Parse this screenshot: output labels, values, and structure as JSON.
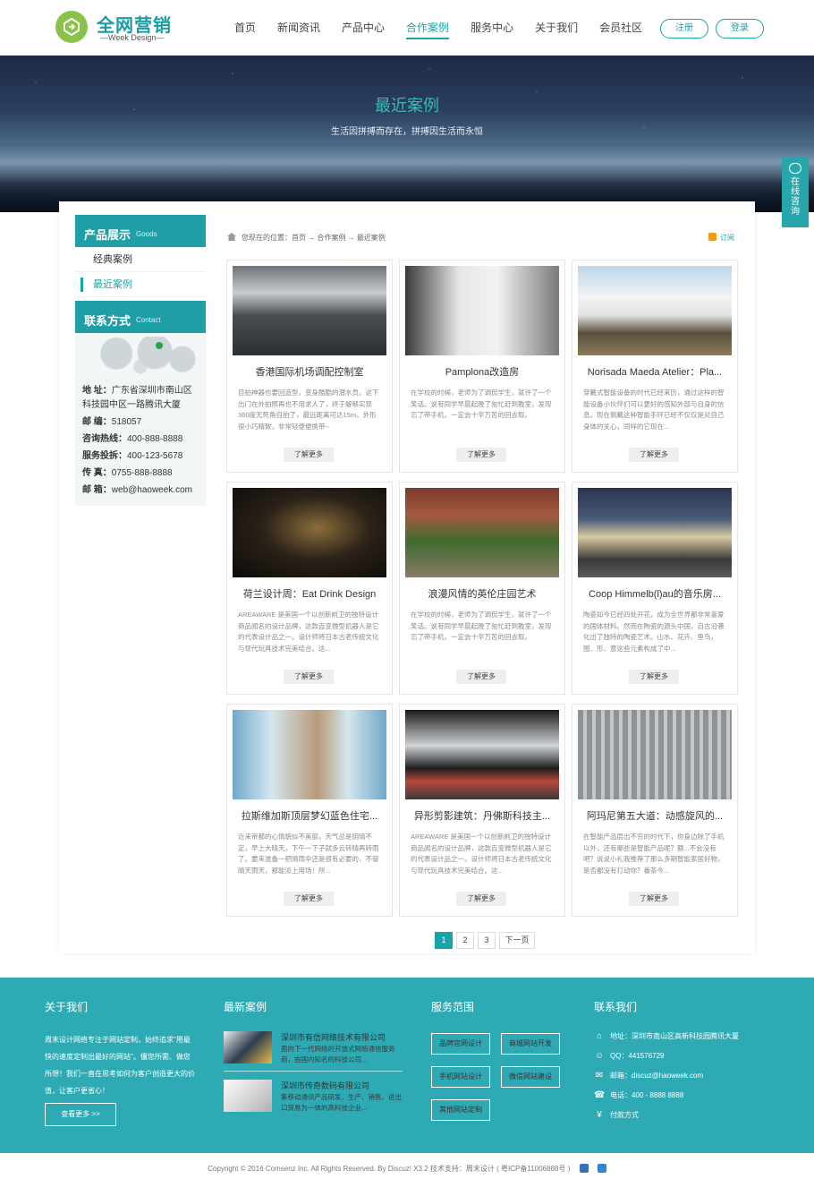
{
  "brand": {
    "name": "全网营销",
    "sub": "—Week Design—",
    "color": "#1aa3a8"
  },
  "nav": {
    "items": [
      {
        "label": "首页"
      },
      {
        "label": "新闻资讯"
      },
      {
        "label": "产品中心"
      },
      {
        "label": "合作案例",
        "active": true
      },
      {
        "label": "服务中心"
      },
      {
        "label": "关于我们"
      },
      {
        "label": "会员社区"
      }
    ],
    "register": "注册",
    "login": "登录"
  },
  "banner": {
    "title": "最近案例",
    "subtitle": "生活因拼搏而存在，拼搏因生活而永恒"
  },
  "consult": {
    "label": "在线咨询",
    "icon": "chat-icon"
  },
  "sidebar": {
    "products_title": "产品展示",
    "products_en": "Goods",
    "items": [
      {
        "label": "经典案例"
      },
      {
        "label": "最近案例",
        "active": true
      }
    ],
    "contact_title": "联系方式",
    "contact_en": "Contact",
    "address_label": "地 址：",
    "address_1": "广东省深圳市南山区",
    "address_2": "科技园中区一路腾讯大厦",
    "zip_label": "邮 编：",
    "zip": "518057",
    "hotline_label": "咨询热线：",
    "hotline": "400-888-8888",
    "complaint_label": "服务投拆：",
    "complaint": "400-123-5678",
    "fax_label": "传 真：",
    "fax": "0755-888-8888",
    "email_label": "邮 箱：",
    "email": "web@haoweek.com"
  },
  "breadcrumb": {
    "text": "您现在的位置：首页 → 合作案例 → 最近案例",
    "rss": "订阅"
  },
  "cases": [
    {
      "title": "香港国际机场调配控制室",
      "desc": "目拍神器也要回造型，变身酷酷的潜水员。这下出门在外拍照再也不用求人了，终于解够实现360度无死角自拍了，最远距离可达15m。外形很小巧精致，非常轻便便携带~",
      "more": "了解更多"
    },
    {
      "title": "Pamplona改造房",
      "desc": "在学校的时候，老师为了调侃学生，就许了一个笑话。说有同学早晨起晚了匆忙赶到教室，发现忘了带手机，一定会十辛万苦的回去取。",
      "more": "了解更多"
    },
    {
      "title": "Norisada Maeda Atelier：Pla...",
      "desc": "穿戴式智能设备的时代已经来历，通过这样的智能设备小伙伴们可以更好的感知外部与自身的信息。现在佩戴这种智能手环已经不仅仅是对自己身体的关心，同样的它现在...",
      "more": "了解更多"
    },
    {
      "title": "荷兰设计周：Eat Drink Design",
      "desc": "AREAWARE 是美国一个以创新前卫的独特设计商品闻名的设计品牌，这款百变微型机器人是它的代表设计品之一。设计师将日本古老传统文化与现代玩具技术完美结合。这...",
      "more": "了解更多"
    },
    {
      "title": "浪漫风情的英伦庄园艺术",
      "desc": "在学校的时候，老师为了调侃学生，就许了一个笑话。说有同学早晨起晚了匆忙赶到教室，发现忘了带手机，一定会十辛万苦的回去取。",
      "more": "了解更多"
    },
    {
      "title": "Coop Himmelb(l)au的音乐房...",
      "desc": "陶瓷如今已经四处开花，成为全世界都非常喜爱的国体材料。然而在陶瓷的源头中国，自古沿袭化出了独特的陶瓷艺术。山水、花卉、鱼鸟，图、形、意这些元素构成了中...",
      "more": "了解更多"
    },
    {
      "title": "拉斯维加斯顶层梦幻蓝色住宅...",
      "desc": "近来帝都的心情貌似不美丽，天气总是阴晴不定，早上大晴天，下午一下子就多云转晴再转雨了。要来准备一把晴雨伞还是很有必要的，不管晴天雨天，都能派上用场！所...",
      "more": "了解更多"
    },
    {
      "title": "异形剪影建筑：丹佛斯科技主...",
      "desc": "AREAWARE 是美国一个以创新前卫的独特设计商品闻名的设计品牌，这款百变微型机器人是它的代表设计品之一。设计师将日本古老传统文化与现代玩具技术完美结合。这...",
      "more": "了解更多"
    },
    {
      "title": "阿玛尼第五大道：动感旋风的...",
      "desc": "在智能产品层出不穷的时代下，你身边除了手机以外，还有哪些是智能产品呢？额...不会没有吧？说说小礼我推荐了那么多期智能家居好物，是否都没有打动你？番茶今...",
      "more": "了解更多"
    }
  ],
  "pagination": {
    "pages": [
      "1",
      "2",
      "3"
    ],
    "current": "1",
    "next": "下一页"
  },
  "footer": {
    "about_title": "关于我们",
    "about_text": "周末设计网络专注于网站定制，始终追求\"用最快的速度定制出最好的网站\"。僵您所需、做您所想！我们一直在思考如何为客户创造更大的价值，让客户更省心！",
    "about_more": "查看更多 >>",
    "cases_title": "最新案例",
    "cases": [
      {
        "title": "深圳市有信网络技术有限公司",
        "desc": "面向下一代网络的开放式网络通信服务商，由国内知名的科技公司..."
      },
      {
        "title": "深圳市传奇数码有限公司",
        "desc": "集移动通讯产品研发、生产、销售、进出口贸易为一体的高科技企业..."
      }
    ],
    "service_title": "服务范围",
    "services": [
      "品牌官网设计",
      "商城网站开发",
      "手机网站设计",
      "微信网站建设",
      "其他网站定制"
    ],
    "contact_title": "联系我们",
    "contact": [
      {
        "icon": "home-icon",
        "text": "地址：深圳市南山区高新科技园腾讯大厦"
      },
      {
        "icon": "qq-icon",
        "text": "QQ：441576729"
      },
      {
        "icon": "mail-icon",
        "text": "邮箱：discuz@haoweek.com"
      },
      {
        "icon": "phone-icon",
        "text": "电话：400 - 8888 8888"
      },
      {
        "icon": "yen-icon",
        "text": "付款方式"
      }
    ],
    "bg_color": "#2eaab5"
  },
  "copyright": "Copyright © 2016  Comsenz Inc.  All Rights Reserved. By   Discuz!   X3.2   技术支持：周末设计    ( 粤ICP备11006888号 )"
}
